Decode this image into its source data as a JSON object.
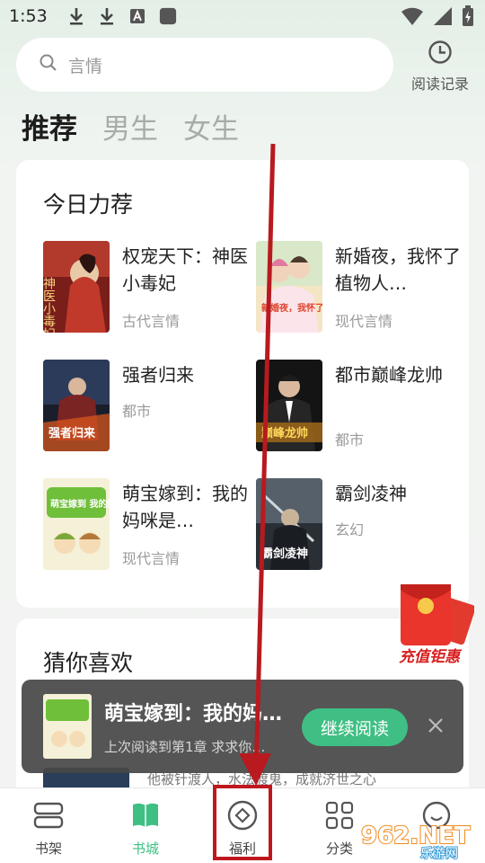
{
  "status_bar": {
    "time": "1:53"
  },
  "search": {
    "placeholder": "言情"
  },
  "history": {
    "label": "阅读记录"
  },
  "tabs": [
    {
      "label": "推荐",
      "active": true
    },
    {
      "label": "男生",
      "active": false
    },
    {
      "label": "女生",
      "active": false
    }
  ],
  "today_recommend": {
    "title": "今日力荐",
    "books": [
      {
        "title": "权宠天下：神医小毒妃",
        "genre": "古代言情",
        "cover_text": "神医小毒妃"
      },
      {
        "title": "新婚夜，我怀了植物人…",
        "genre": "现代言情",
        "cover_text": "新婚夜，我怀了植物人的孩子"
      },
      {
        "title": "强者归来",
        "genre": "都市",
        "cover_text": "强者归来"
      },
      {
        "title": "都市巅峰龙帅",
        "genre": "都市",
        "cover_text": "巅峰龙帅"
      },
      {
        "title": "萌宝嫁到：我的妈咪是…",
        "genre": "现代言情",
        "cover_text": "萌宝嫁到 我的妈咪是大佬"
      },
      {
        "title": "霸剑凌神",
        "genre": "玄幻",
        "cover_text": "霸剑凌神"
      }
    ]
  },
  "guess": {
    "title": "猜你喜欢",
    "partial_text": "他被针渡人，水法渡鬼，成就济世之心"
  },
  "continue_reading": {
    "title": "萌宝嫁到：我的妈…",
    "subtitle": "上次阅读到第1章 求求你…",
    "button": "继续阅读"
  },
  "red_packet": {
    "label": "充值钜惠"
  },
  "bottom_nav": [
    {
      "label": "书架",
      "icon": "bookshelf-icon",
      "active": false
    },
    {
      "label": "书城",
      "icon": "book-open-icon",
      "active": true
    },
    {
      "label": "福利",
      "icon": "welfare-icon",
      "active": false
    },
    {
      "label": "分类",
      "icon": "grid-icon",
      "active": false
    },
    {
      "label": "",
      "icon": "profile-icon",
      "active": false
    }
  ],
  "watermark": {
    "text": "962.NET",
    "sub": "乐游网"
  },
  "colors": {
    "accent": "#3fbf84",
    "annotation": "#c0171d"
  }
}
